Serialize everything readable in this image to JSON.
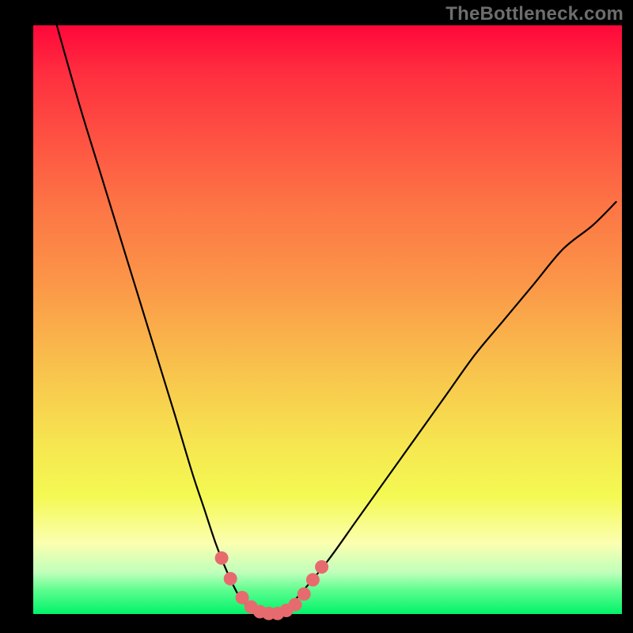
{
  "watermark": "TheBottleneck.com",
  "chart_data": {
    "type": "line",
    "title": "",
    "xlabel": "",
    "ylabel": "",
    "xlim": [
      0,
      100
    ],
    "ylim": [
      0,
      100
    ],
    "grid": false,
    "legend": false,
    "series": [
      {
        "name": "bottleneck-curve",
        "x": [
          4,
          8,
          12,
          16,
          20,
          24,
          27,
          29,
          31,
          33,
          35,
          37,
          39,
          41,
          43,
          45,
          50,
          55,
          60,
          65,
          70,
          75,
          80,
          85,
          90,
          95,
          99
        ],
        "y": [
          100,
          86,
          73,
          60,
          47,
          34,
          24,
          18,
          12,
          7,
          3,
          1,
          0,
          0,
          1,
          3,
          9,
          16,
          23,
          30,
          37,
          44,
          50,
          56,
          62,
          66,
          70
        ],
        "color": "#000000"
      },
      {
        "name": "bottleneck-markers",
        "type": "scatter",
        "x": [
          32.0,
          33.5,
          35.5,
          37.0,
          38.5,
          40.0,
          41.5,
          43.0,
          44.5,
          46.0,
          47.5,
          49.0
        ],
        "y": [
          9.5,
          6.0,
          2.8,
          1.2,
          0.4,
          0.1,
          0.1,
          0.6,
          1.6,
          3.4,
          5.8,
          8.0
        ],
        "color": "#e76b6e",
        "marker_size": 11
      }
    ],
    "background_gradient": {
      "type": "vertical",
      "stops": [
        {
          "pos": 0.0,
          "color": "#ff073a"
        },
        {
          "pos": 0.3,
          "color": "#fd7345"
        },
        {
          "pos": 0.6,
          "color": "#f8c74d"
        },
        {
          "pos": 0.8,
          "color": "#f4f953"
        },
        {
          "pos": 0.93,
          "color": "#bfffbb"
        },
        {
          "pos": 1.0,
          "color": "#00f36a"
        }
      ]
    }
  }
}
